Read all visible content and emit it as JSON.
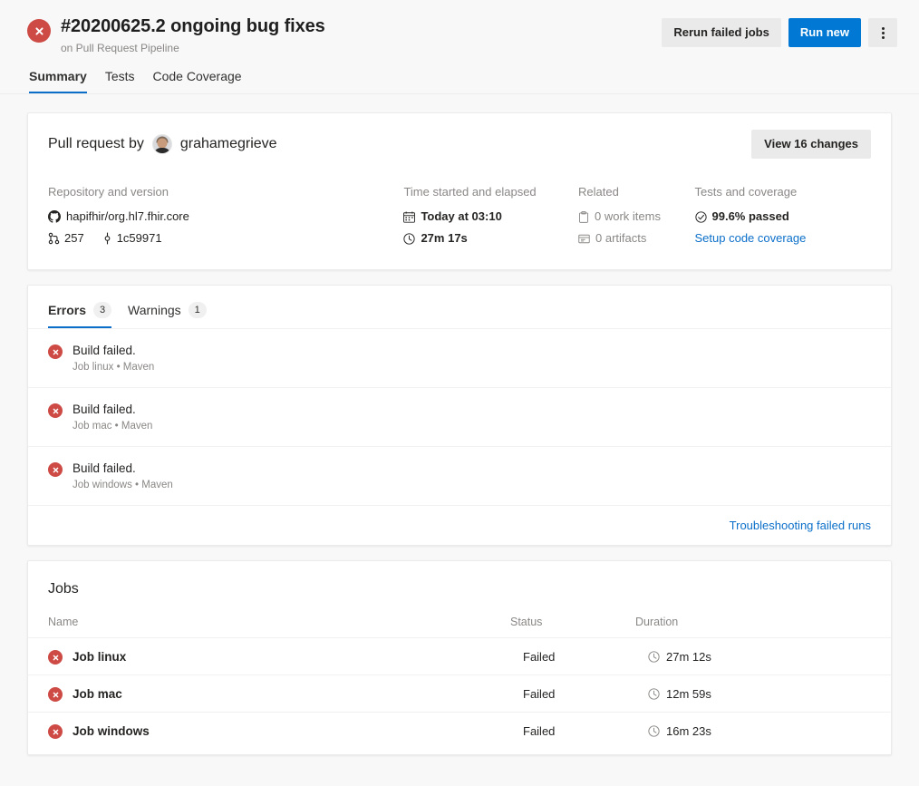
{
  "header": {
    "status_icon": "error-circle-icon",
    "title": "#20200625.2 ongoing bug fixes",
    "subtitle": "on Pull Request Pipeline",
    "actions": {
      "rerun_label": "Rerun failed jobs",
      "run_new_label": "Run new",
      "more_label": "more-actions"
    }
  },
  "pivot": {
    "tabs": [
      {
        "label": "Summary",
        "active": true
      },
      {
        "label": "Tests",
        "active": false
      },
      {
        "label": "Code Coverage",
        "active": false
      }
    ]
  },
  "pr_card": {
    "by_prefix": "Pull request by",
    "author": "grahamegrieve",
    "avatar": "user-avatar",
    "view_changes_label": "View 16 changes",
    "columns": {
      "repository": {
        "heading": "Repository and version",
        "repo_icon": "github-icon",
        "repo": "hapifhir/org.hl7.fhir.core",
        "pr_icon": "pull-request-icon",
        "pr_number": "257",
        "commit_icon": "commit-icon",
        "commit": "1c59971"
      },
      "time": {
        "heading": "Time started and elapsed",
        "calendar_icon": "calendar-icon",
        "started": "Today at 03:10",
        "clock_icon": "clock-icon",
        "elapsed": "27m 17s"
      },
      "related": {
        "heading": "Related",
        "work_items_icon": "work-item-icon",
        "work_items": "0 work items",
        "artifacts_icon": "artifact-icon",
        "artifacts": "0 artifacts"
      },
      "tests": {
        "heading": "Tests and coverage",
        "passed_icon": "check-circle-icon",
        "passed": "99.6% passed",
        "coverage_link": "Setup code coverage"
      }
    }
  },
  "issues_card": {
    "tabs": [
      {
        "label": "Errors",
        "count": "3",
        "active": true
      },
      {
        "label": "Warnings",
        "count": "1",
        "active": false
      }
    ],
    "items": [
      {
        "icon": "error-circle-icon",
        "title": "Build failed.",
        "subtitle": "Job linux • Maven"
      },
      {
        "icon": "error-circle-icon",
        "title": "Build failed.",
        "subtitle": "Job mac • Maven"
      },
      {
        "icon": "error-circle-icon",
        "title": "Build failed.",
        "subtitle": "Job windows • Maven"
      }
    ],
    "footer_link": "Troubleshooting failed runs"
  },
  "jobs_card": {
    "title": "Jobs",
    "columns": {
      "name": "Name",
      "status": "Status",
      "duration": "Duration"
    },
    "rows": [
      {
        "icon": "error-circle-icon",
        "name": "Job linux",
        "status": "Failed",
        "duration_icon": "clock-icon",
        "duration": "27m 12s"
      },
      {
        "icon": "error-circle-icon",
        "name": "Job mac",
        "status": "Failed",
        "duration_icon": "clock-icon",
        "duration": "12m 59s"
      },
      {
        "icon": "error-circle-icon",
        "name": "Job windows",
        "status": "Failed",
        "duration_icon": "clock-icon",
        "duration": "16m 23s"
      }
    ]
  },
  "colors": {
    "accent_blue": "#0078d4",
    "link_blue": "#0b6fc9",
    "error_red": "#cd4a45",
    "page_bg": "#f8f8f8",
    "card_bg": "#ffffff",
    "muted_text": "#8a8886"
  }
}
